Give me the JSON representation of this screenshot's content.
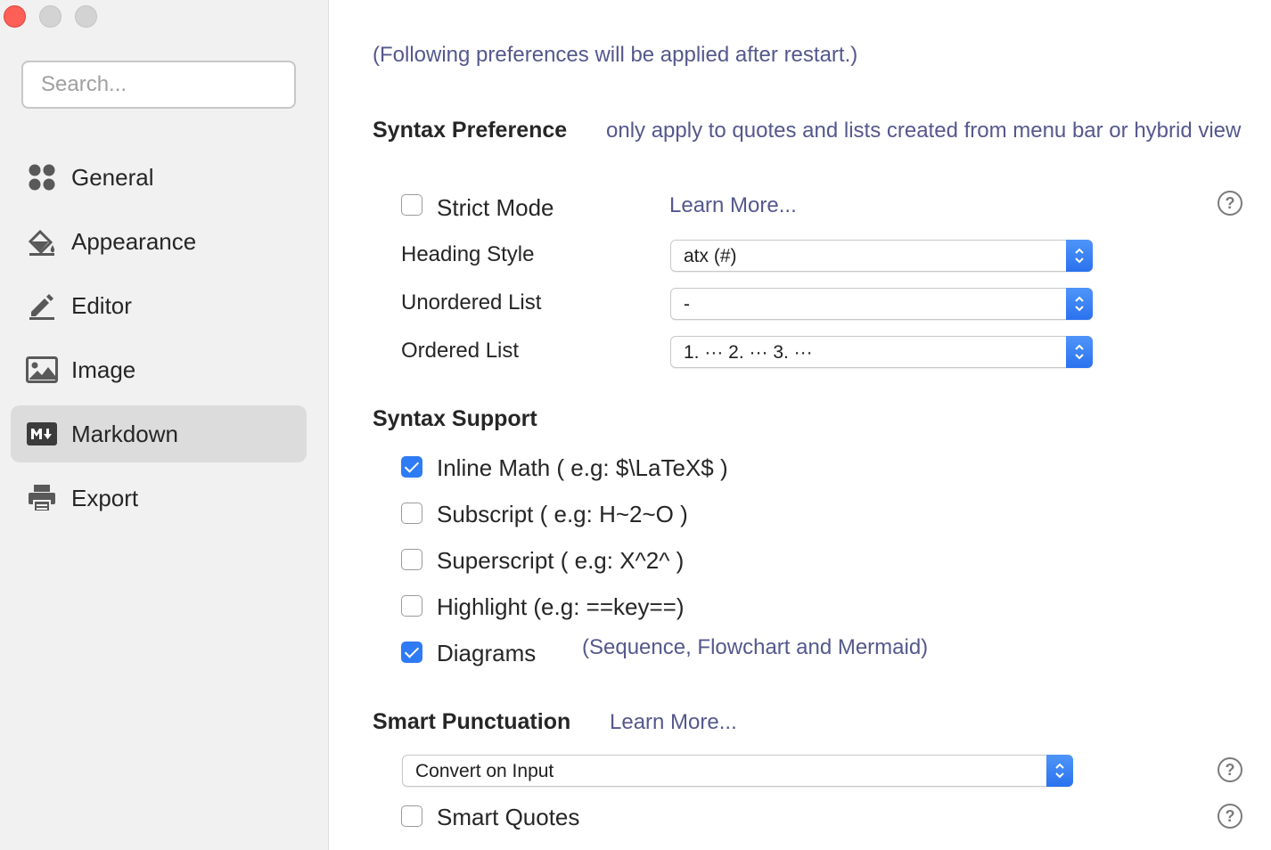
{
  "window": {
    "controls": [
      "close",
      "minimize",
      "maximize"
    ]
  },
  "search": {
    "placeholder": "Search..."
  },
  "sidebar": {
    "items": [
      {
        "label": "General",
        "icon": "grid-icon",
        "active": false
      },
      {
        "label": "Appearance",
        "icon": "paint-bucket-icon",
        "active": false
      },
      {
        "label": "Editor",
        "icon": "pencil-icon",
        "active": false
      },
      {
        "label": "Image",
        "icon": "image-icon",
        "active": false
      },
      {
        "label": "Markdown",
        "icon": "markdown-icon",
        "active": true
      },
      {
        "label": "Export",
        "icon": "printer-icon",
        "active": false
      }
    ]
  },
  "main": {
    "note": "(Following preferences will be applied after restart.)",
    "syntax_preference": {
      "title": "Syntax Preference",
      "hint": "only apply to quotes and lists created from menu bar or hybrid view",
      "strict_mode": {
        "label": "Strict Mode",
        "checked": false,
        "link": "Learn More..."
      },
      "heading_style": {
        "label": "Heading Style",
        "value": "atx (#)"
      },
      "unordered_list": {
        "label": "Unordered List",
        "value": "-"
      },
      "ordered_list": {
        "label": "Ordered List",
        "value": "1. ··· 2. ··· 3. ···"
      }
    },
    "syntax_support": {
      "title": "Syntax Support",
      "items": [
        {
          "label": "Inline Math ( e.g: $\\LaTeX$ )",
          "checked": true
        },
        {
          "label": "Subscript ( e.g: H~2~O )",
          "checked": false
        },
        {
          "label": "Superscript ( e.g: X^2^ )",
          "checked": false
        },
        {
          "label": "Highlight (e.g: ==key==)",
          "checked": false
        },
        {
          "label": "Diagrams",
          "checked": true,
          "hint": "(Sequence, Flowchart and Mermaid)"
        }
      ]
    },
    "smart_punctuation": {
      "title": "Smart Punctuation",
      "link": "Learn More...",
      "mode": "Convert on Input",
      "smart_quotes": {
        "label": "Smart Quotes",
        "checked": false
      }
    }
  },
  "colors": {
    "accent": "#2f7bf5",
    "link": "#54588c",
    "sidebar_bg": "#f1f1f1",
    "active_item_bg": "#dcdcdc",
    "close_button": "#fe5f57"
  }
}
